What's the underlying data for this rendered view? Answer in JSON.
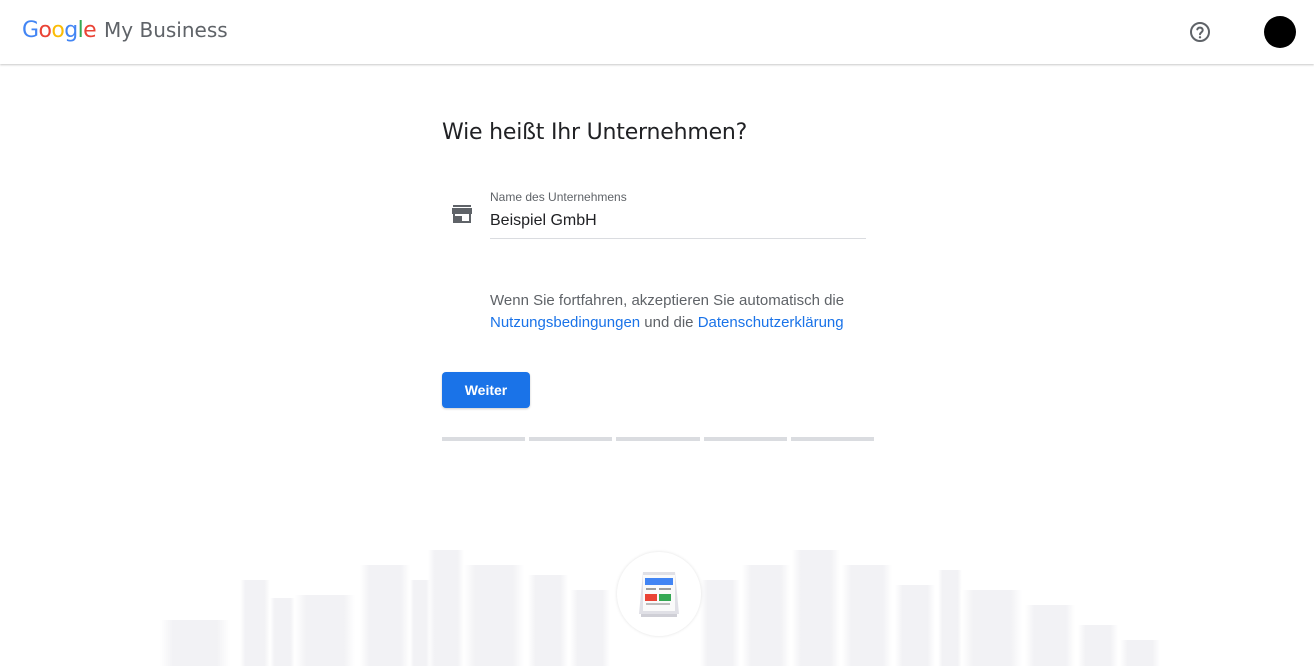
{
  "header": {
    "logo_letters": [
      "G",
      "o",
      "o",
      "g",
      "l",
      "e"
    ],
    "logo_colors": [
      "#4285F4",
      "#EA4335",
      "#FBBC05",
      "#4285F4",
      "#34A853",
      "#EA4335"
    ],
    "product_name": "My Business",
    "help_icon": "help-circle-icon",
    "avatar_color": "#000000"
  },
  "main": {
    "title": "Wie heißt Ihr Unternehmen?",
    "field": {
      "icon": "storefront-icon",
      "label": "Name des Unternehmens",
      "value": "Beispiel GmbH"
    },
    "terms": {
      "text_before": "Wenn Sie fortfahren, akzeptieren Sie automatisch die",
      "link_terms": "Nutzungsbedingungen",
      "connector": "und die",
      "link_privacy": "Datenschutzerklärung"
    },
    "continue_button": "Weiter",
    "progress": {
      "steps": 5,
      "completed": 0
    }
  },
  "colors": {
    "accent": "#1a73e8",
    "text_primary": "#202124",
    "text_secondary": "#5f6368",
    "divider": "#dadce0"
  },
  "illustration": {
    "icon": "storefront-sign-icon"
  }
}
